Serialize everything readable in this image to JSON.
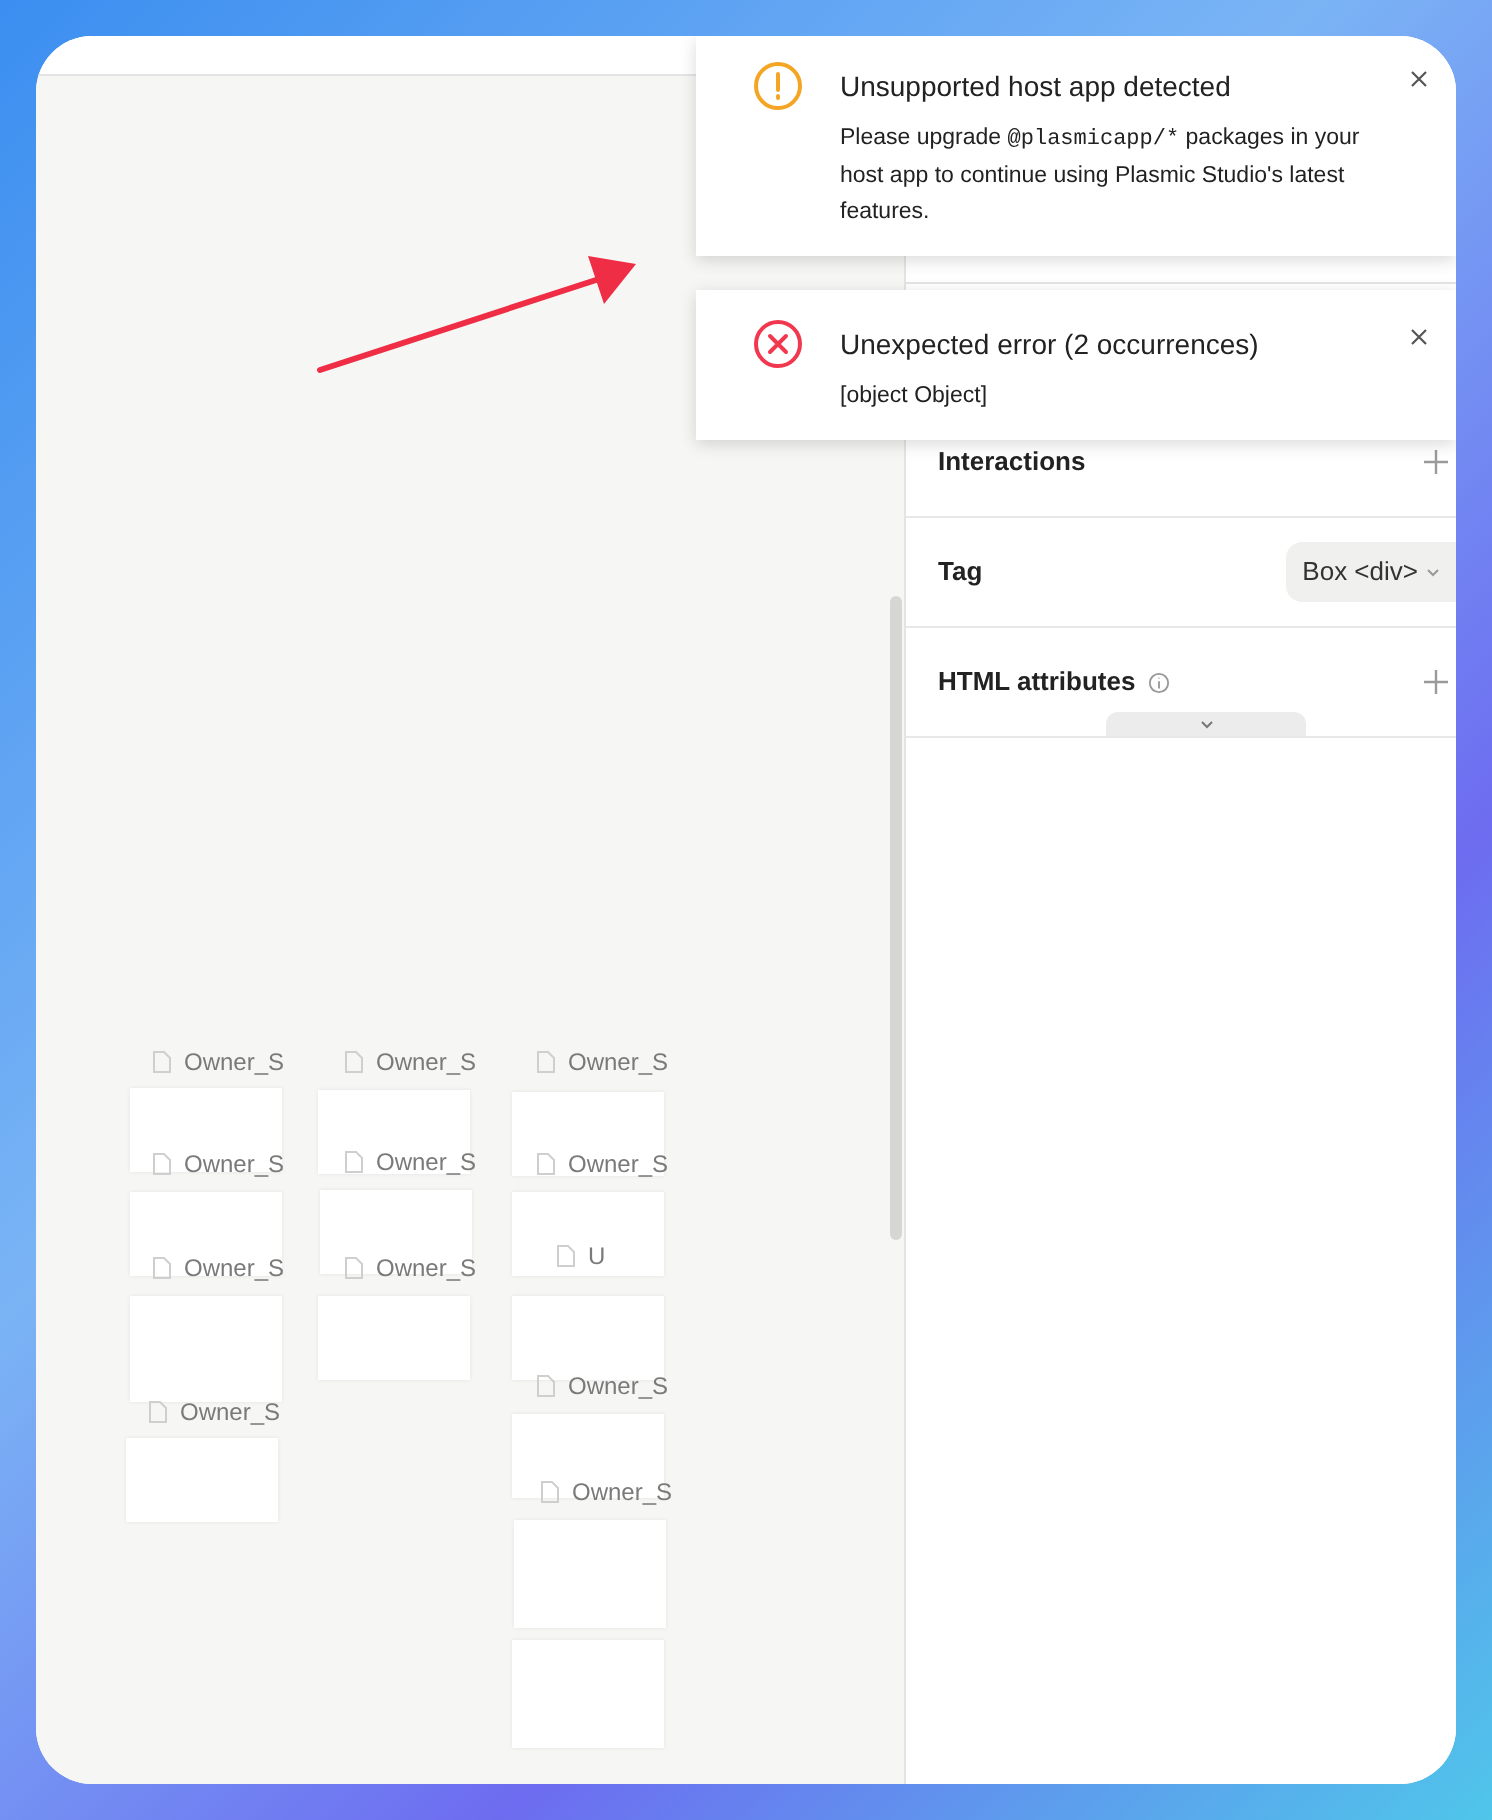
{
  "canvas": {
    "frames": [
      {
        "kind": "labeled",
        "label": "Owner_S"
      },
      {
        "kind": "labeled",
        "label": "Owner_S"
      },
      {
        "kind": "labeled",
        "label": "Owner_S"
      },
      {
        "kind": "labeled",
        "label": "Owner_S"
      },
      {
        "kind": "labeled",
        "label": "Owner_S"
      },
      {
        "kind": "labeled",
        "label": "Owner_S"
      },
      {
        "kind": "labeled",
        "label": "Owner_S"
      },
      {
        "kind": "labeled",
        "label": "Owner_S"
      },
      {
        "kind": "labeled",
        "label": "Owner_S"
      },
      {
        "kind": "labeled",
        "label": "U"
      },
      {
        "kind": "labeled",
        "label": "Owner_S"
      },
      {
        "kind": "labeled",
        "label": "Owner_S"
      },
      {
        "kind": "plain"
      }
    ]
  },
  "panel": {
    "sections": [
      {
        "kind": "add",
        "label": "Interactions"
      },
      {
        "kind": "select",
        "label": "Tag",
        "value": "Box <div>"
      },
      {
        "kind": "info-add",
        "label": "HTML attributes"
      }
    ]
  },
  "toasts": [
    {
      "kind": "warning",
      "title": "Unsupported host app detected",
      "message": [
        {
          "kind": "text",
          "text": "Please upgrade "
        },
        {
          "kind": "code",
          "text": "@plasmicapp/*"
        },
        {
          "kind": "text",
          "text": " packages in your host app to continue using Plasmic Studio's latest features."
        }
      ]
    },
    {
      "kind": "error",
      "title": "Unexpected error (2 occurrences)",
      "message": [
        {
          "kind": "text",
          "text": "[object Object]"
        }
      ]
    }
  ]
}
